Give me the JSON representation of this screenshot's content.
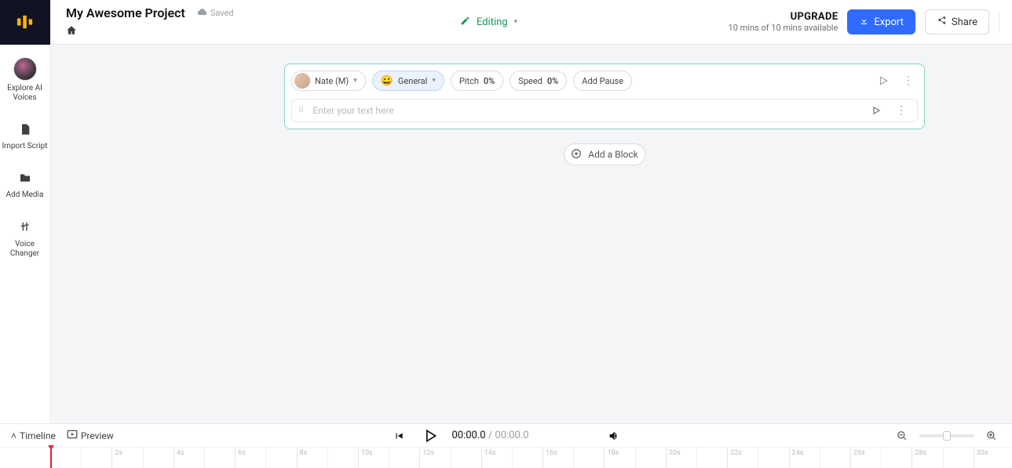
{
  "header": {
    "project_title": "My Awesome Project",
    "saved_label": "Saved",
    "mode_label": "Editing",
    "upgrade_label": "UPGRADE",
    "quota_text": "10 mins of 10 mins available",
    "export_label": "Export",
    "share_label": "Share"
  },
  "sidebar": {
    "items": [
      {
        "label": "Explore AI Voices",
        "icon": "avatar"
      },
      {
        "label": "Import Script",
        "icon": "document"
      },
      {
        "label": "Add Media",
        "icon": "folder"
      },
      {
        "label": "Voice Changer",
        "icon": "sliders"
      }
    ]
  },
  "block": {
    "voice_name": "Nate (M)",
    "style_label": "General",
    "pitch_label": "Pitch",
    "pitch_value": "0%",
    "speed_label": "Speed",
    "speed_value": "0%",
    "add_pause_label": "Add Pause",
    "text_placeholder": "Enter your text here"
  },
  "add_block_label": "Add a Block",
  "playback": {
    "timeline_label": "Timeline",
    "preview_label": "Preview",
    "current_time": "00:00.0",
    "total_time": "00:00.0"
  },
  "ruler": {
    "ticks": [
      "2s",
      "4s",
      "6s",
      "8s",
      "10s",
      "12s",
      "14s",
      "16s",
      "18s",
      "20s",
      "22s",
      "24s",
      "26s",
      "28s",
      "30s"
    ]
  }
}
